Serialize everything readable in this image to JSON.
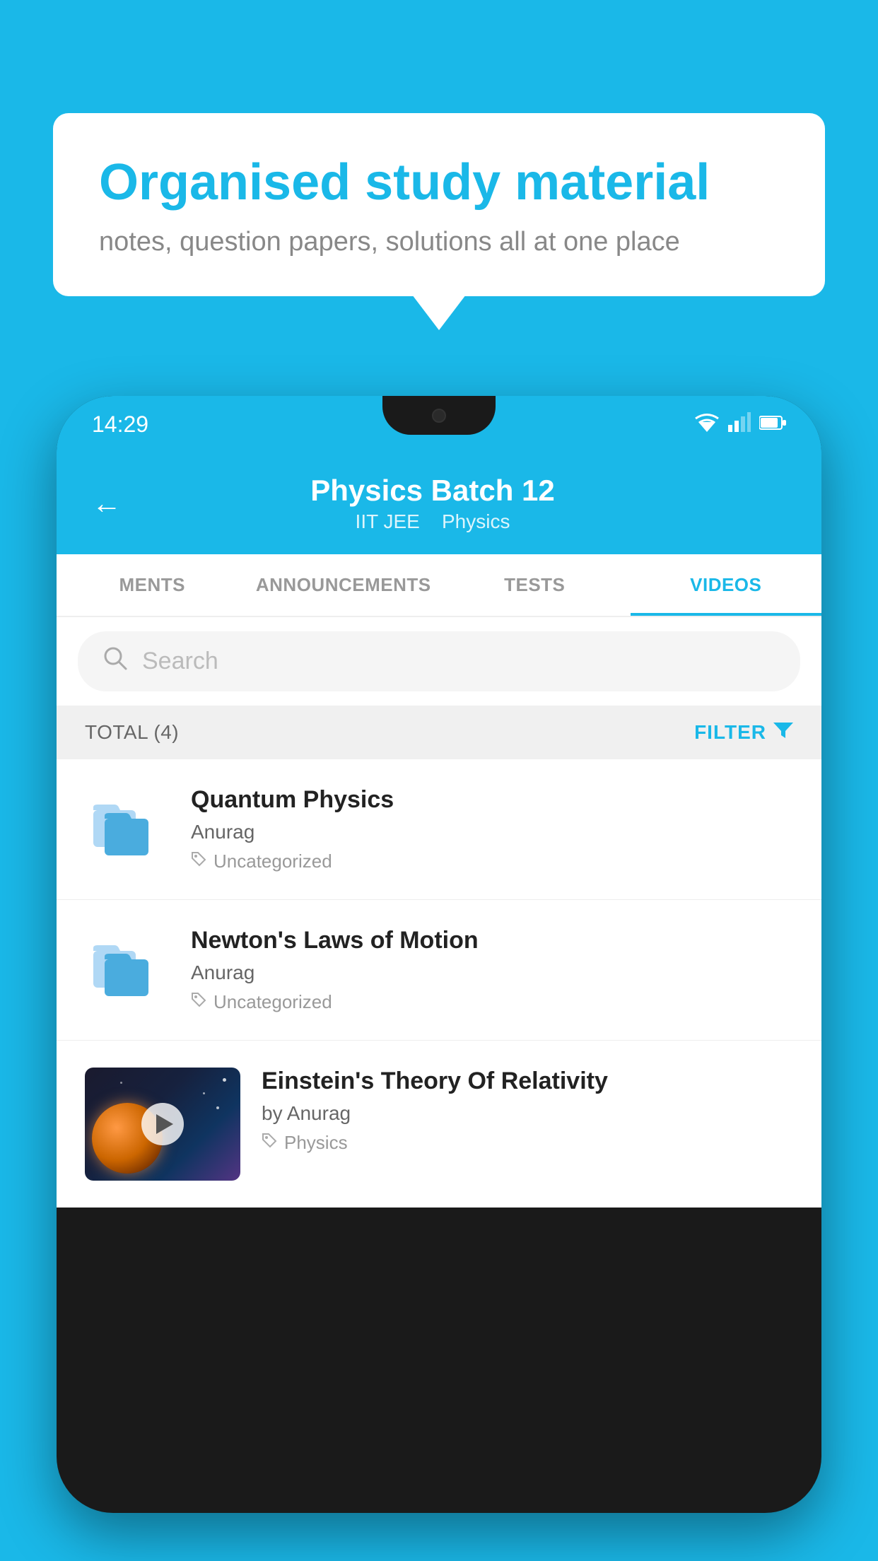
{
  "background": {
    "color": "#1ab8e8"
  },
  "speech_bubble": {
    "title": "Organised study material",
    "subtitle": "notes, question papers, solutions all at one place"
  },
  "phone": {
    "status_bar": {
      "time": "14:29"
    },
    "header": {
      "back_label": "←",
      "title": "Physics Batch 12",
      "subtitle_iit": "IIT JEE",
      "subtitle_physics": "Physics"
    },
    "tabs": [
      {
        "label": "MENTS",
        "active": false
      },
      {
        "label": "ANNOUNCEMENTS",
        "active": false
      },
      {
        "label": "TESTS",
        "active": false
      },
      {
        "label": "VIDEOS",
        "active": true
      }
    ],
    "search": {
      "placeholder": "Search"
    },
    "filter": {
      "total_label": "TOTAL (4)",
      "filter_label": "FILTER"
    },
    "videos": [
      {
        "id": 1,
        "title": "Quantum Physics",
        "author": "Anurag",
        "tag": "Uncategorized",
        "type": "folder"
      },
      {
        "id": 2,
        "title": "Newton's Laws of Motion",
        "author": "Anurag",
        "tag": "Uncategorized",
        "type": "folder"
      },
      {
        "id": 3,
        "title": "Einstein's Theory Of Relativity",
        "author": "by Anurag",
        "tag": "Physics",
        "type": "video"
      }
    ]
  }
}
